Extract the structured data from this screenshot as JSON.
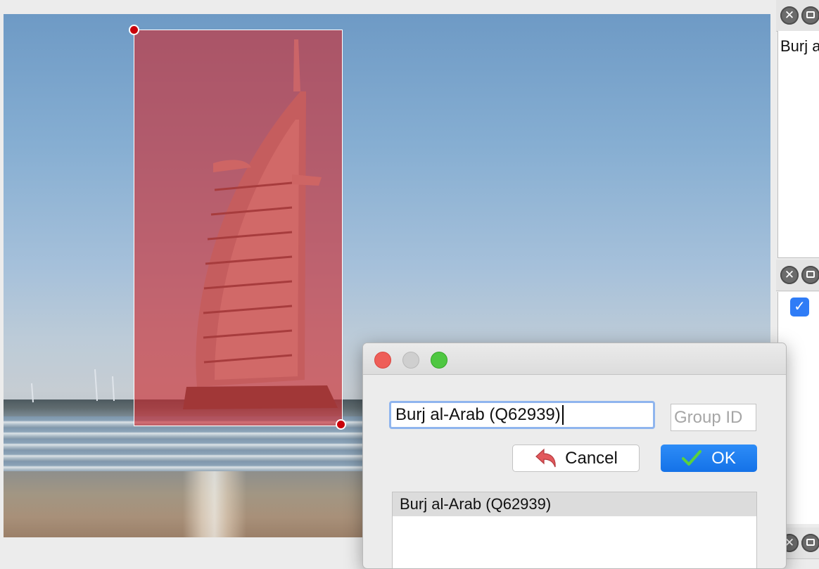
{
  "dialog": {
    "name_value": "Burj al-Arab (Q62939)",
    "group_placeholder": "Group ID",
    "cancel_label": "Cancel",
    "ok_label": "OK",
    "results": [
      {
        "label": "Burj al-Arab (Q62939)"
      }
    ]
  },
  "side_panel": {
    "label_text": "Burj a"
  },
  "colors": {
    "selection_fill": "#cd282d",
    "handle": "#c9000a",
    "ok_button": "#1a7ef0",
    "input_focus": "#8fb5ee"
  },
  "icons": {
    "close": "close-icon",
    "float": "float-window-icon",
    "checkbox": "checkmark-icon",
    "cancel": "undo-arrow-icon",
    "ok": "green-check-icon"
  }
}
